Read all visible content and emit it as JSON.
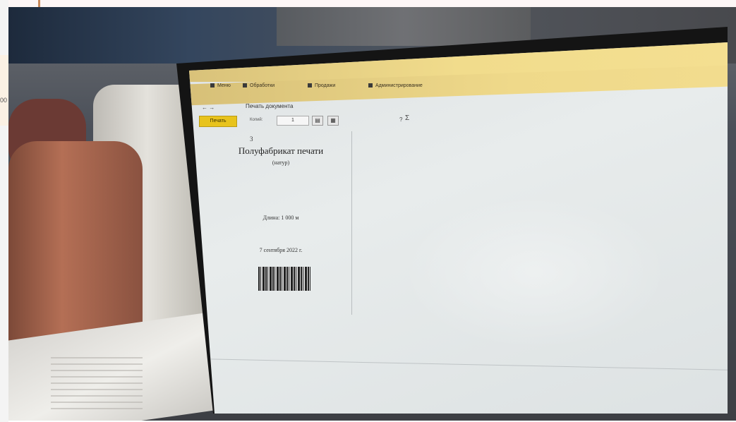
{
  "host": {
    "left_fragment": "00"
  },
  "screen_app": {
    "title_text": "",
    "commands": [
      {
        "icon": "home-icon",
        "label": "Меню"
      },
      {
        "icon": "document-icon",
        "label": "Обработки"
      },
      {
        "icon": "chart-icon",
        "label": "Продажи"
      },
      {
        "icon": "flag-icon",
        "label": "Администрирование"
      }
    ],
    "nav": "← →",
    "print_dialog_title": "Печать документа",
    "print_button_label": "Печать",
    "copies_label": "Копий:",
    "copies_value": "1",
    "label_number": "3",
    "label_product": "Полуфабрикат печати",
    "label_subtitle": "(натур)",
    "label_length": "Длина: 1 000 м",
    "label_date": "7 сентября 2022 г."
  },
  "colors": {
    "app_title_bar": "#f1dc8c",
    "print_button": "#e8c31c",
    "screen_background": "#e4e8e9"
  }
}
